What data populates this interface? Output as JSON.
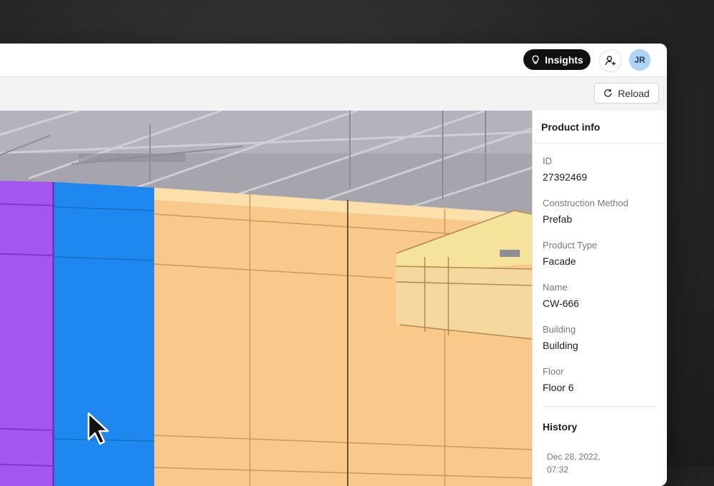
{
  "header": {
    "insights_label": "Insights",
    "avatar_initials": "JR"
  },
  "toolbar": {
    "reload_label": "Reload"
  },
  "panel": {
    "title": "Product info",
    "fields": [
      {
        "label": "ID",
        "value": "27392469"
      },
      {
        "label": "Construction Method",
        "value": "Prefab"
      },
      {
        "label": "Product Type",
        "value": "Facade"
      },
      {
        "label": "Name",
        "value": "CW-666"
      },
      {
        "label": "Building",
        "value": "Building"
      },
      {
        "label": "Floor",
        "value": "Floor 6"
      }
    ],
    "history_title": "History",
    "history_entry": "Dec 28, 2022, 07:32"
  },
  "colors": {
    "selected_panel": "#1e88f0",
    "purple_panel": "#a356f0",
    "facade_panel": "#f8c98a"
  },
  "icons": [
    "lightbulb-icon",
    "add-user-icon",
    "reload-icon",
    "mouse-cursor-icon"
  ]
}
